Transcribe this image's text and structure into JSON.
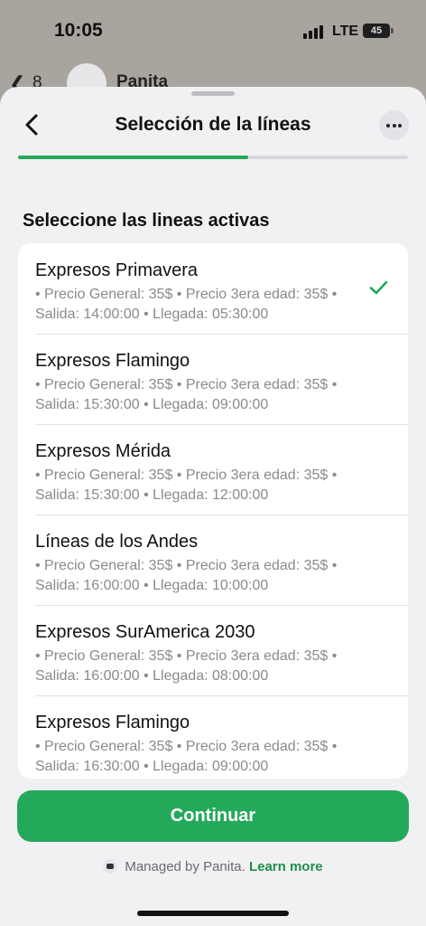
{
  "status_bar": {
    "time": "10:05",
    "network": "LTE",
    "battery": "45"
  },
  "background_chat": {
    "back_count": "8",
    "name": "Panita"
  },
  "sheet": {
    "title": "Selección de la líneas",
    "progress": 0.59,
    "section_label": "Seleccione las lineas activas",
    "items": [
      {
        "title": "Expresos Primavera",
        "desc": "• Precio General: 35$ • Precio 3era edad: 35$ • Salida: 14:00:00 • Llegada: 05:30:00",
        "selected": true
      },
      {
        "title": "Expresos Flamingo",
        "desc": "• Precio General: 35$ • Precio 3era edad: 35$ • Salida: 15:30:00 • Llegada: 09:00:00",
        "selected": false
      },
      {
        "title": "Expresos Mérida",
        "desc": "• Precio General: 35$ • Precio 3era edad: 35$ • Salida: 15:30:00 • Llegada: 12:00:00",
        "selected": false
      },
      {
        "title": "Líneas de los Andes",
        "desc": "• Precio General: 35$ • Precio 3era edad: 35$ • Salida: 16:00:00 • Llegada: 10:00:00",
        "selected": false
      },
      {
        "title": "Expresos SurAmerica 2030",
        "desc": "• Precio General: 35$ • Precio 3era edad: 35$ • Salida: 16:00:00 • Llegada: 08:00:00",
        "selected": false
      },
      {
        "title": "Expresos Flamingo",
        "desc": "• Precio General: 35$ • Precio 3era edad: 35$ • Salida: 16:30:00 • Llegada: 09:00:00",
        "selected": false
      }
    ],
    "continue_label": "Continuar",
    "footer": {
      "managed_text": "Managed by Panita.",
      "learn_more": "Learn more"
    }
  },
  "colors": {
    "accent": "#24a95a",
    "link": "#1f8f4c",
    "sheet_bg": "#f1f1f3"
  },
  "icons": {
    "back": "chevron-left-icon",
    "more": "more-horizontal-icon",
    "check": "check-icon"
  }
}
